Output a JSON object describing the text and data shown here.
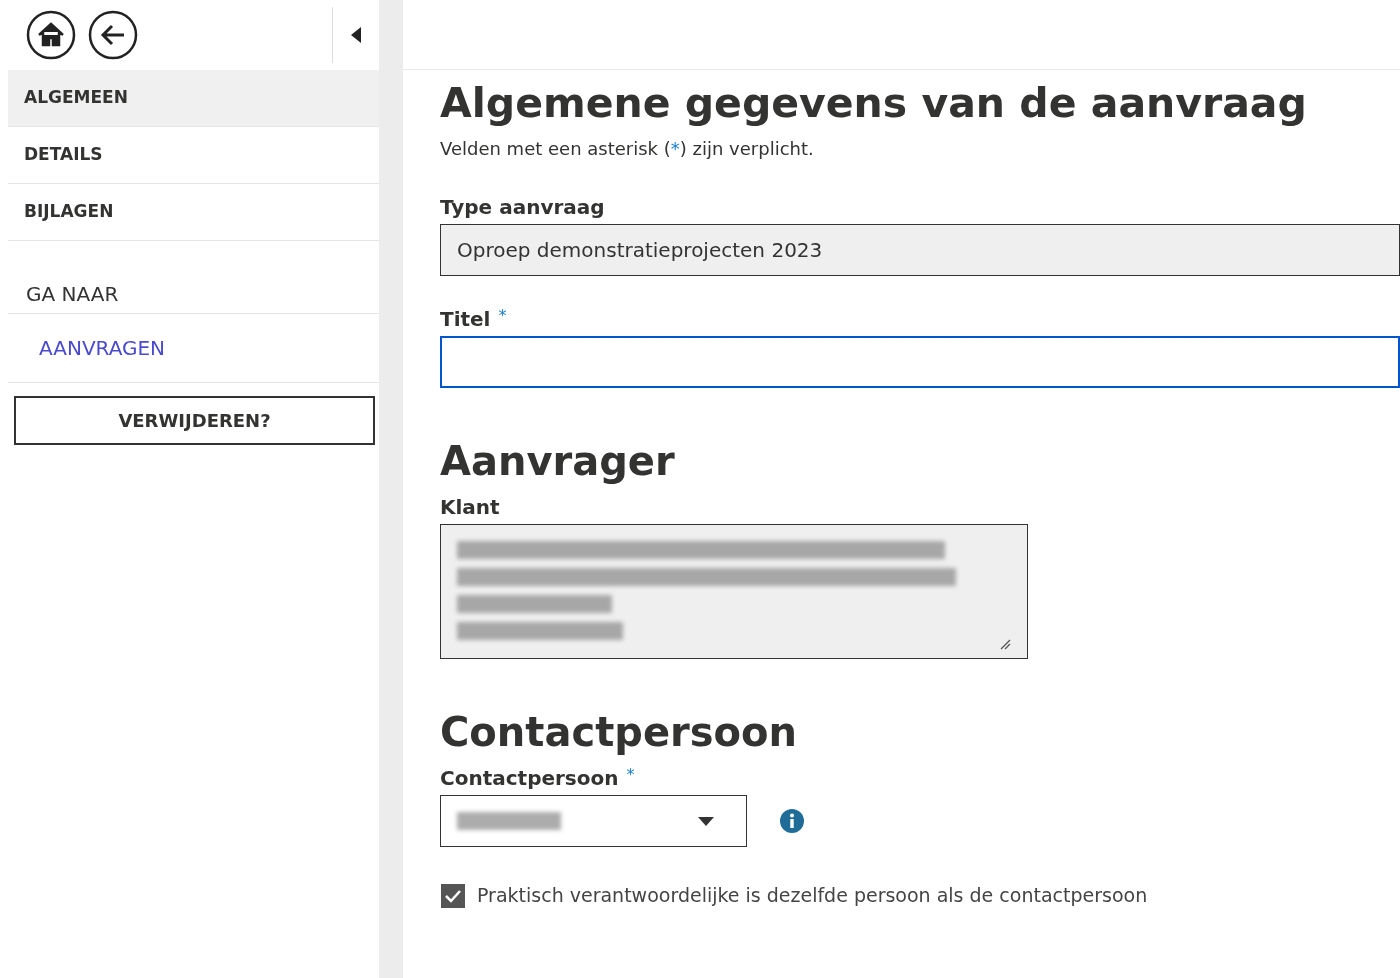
{
  "sidebar": {
    "items": [
      {
        "label": "ALGEMEEN",
        "selected": true
      },
      {
        "label": "DETAILS",
        "selected": false
      },
      {
        "label": "BIJLAGEN",
        "selected": false
      }
    ],
    "goto_heading": "GA NAAR",
    "goto_links": [
      "AANVRAGEN"
    ],
    "delete_button": "VERWIJDEREN?"
  },
  "page": {
    "title": "Algemene gegevens van de aanvraag",
    "note": {
      "before": "Velden met een asterisk (",
      "mark": "*",
      "after": ") zijn verplicht."
    },
    "fields": [
      {
        "kind": "text",
        "label": "Type aanvraag",
        "value": "Oproep demonstratieprojecten 2023",
        "disabled": true
      },
      {
        "kind": "text",
        "label": "Titel",
        "required_mark": "*",
        "disabled": false,
        "focused": true
      }
    ],
    "sections": [
      {
        "heading": "Aanvrager",
        "fields": [
          {
            "kind": "textarea",
            "label": "Klant",
            "disabled": true
          }
        ]
      },
      {
        "heading": "Contactpersoon",
        "fields": [
          {
            "kind": "select",
            "label": "Contactpersoon",
            "required_mark": "*",
            "disabled": false,
            "info": true
          }
        ]
      }
    ],
    "checkbox": {
      "label": "Praktisch verantwoordelijke is dezelfde persoon als de contactpersoon",
      "checked": true
    }
  }
}
